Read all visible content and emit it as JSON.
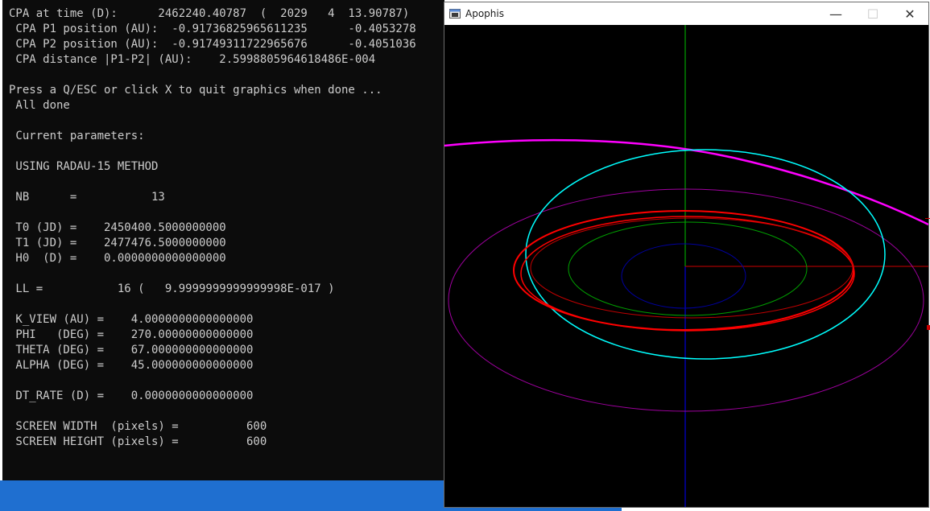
{
  "console": {
    "lines": [
      "CPA at time (D):      2462240.40787  (  2029   4  13.90787)",
      " CPA P1 position (AU):  -0.91736825965611235      -0.4053278",
      " CPA P2 position (AU):  -0.91749311722965676      -0.4051036",
      " CPA distance |P1-P2| (AU):    2.5998805964618486E-004",
      "",
      "Press a Q/ESC or click X to quit graphics when done ...",
      " All done",
      "",
      " Current parameters:",
      "",
      " USING RADAU-15 METHOD",
      "",
      " NB      =           13",
      "",
      " T0 (JD) =    2450400.5000000000",
      " T1 (JD) =    2477476.5000000000",
      " H0  (D) =    0.0000000000000000",
      "",
      " LL =           16 (   9.9999999999999998E-017 )",
      "",
      " K_VIEW (AU) =    4.0000000000000000",
      " PHI   (DEG) =    270.00000000000000",
      " THETA (DEG) =    67.000000000000000",
      " ALPHA (DEG) =    45.000000000000000",
      "",
      " DT_RATE (D) =    0.0000000000000000",
      "",
      " SCREEN WIDTH  (pixels) =          600",
      " SCREEN HEIGHT (pixels) =          600"
    ]
  },
  "window": {
    "title": "Apophis",
    "minimize": "—",
    "maximize": "☐",
    "close": "✕"
  },
  "colors": {
    "console_bg": "#0c0c0c",
    "console_text": "#cccccc",
    "axis_y": "#00c000",
    "axis_z": "#0000ff",
    "axis_x": "#cc0000",
    "inner_orbit": "#0000a0",
    "green_orbit": "#00a000",
    "red_orbit": "#ff0000",
    "cyan_orbit": "#00ffff",
    "magenta_orbit": "#ff00ff",
    "purple_orbit": "#a000a0"
  }
}
